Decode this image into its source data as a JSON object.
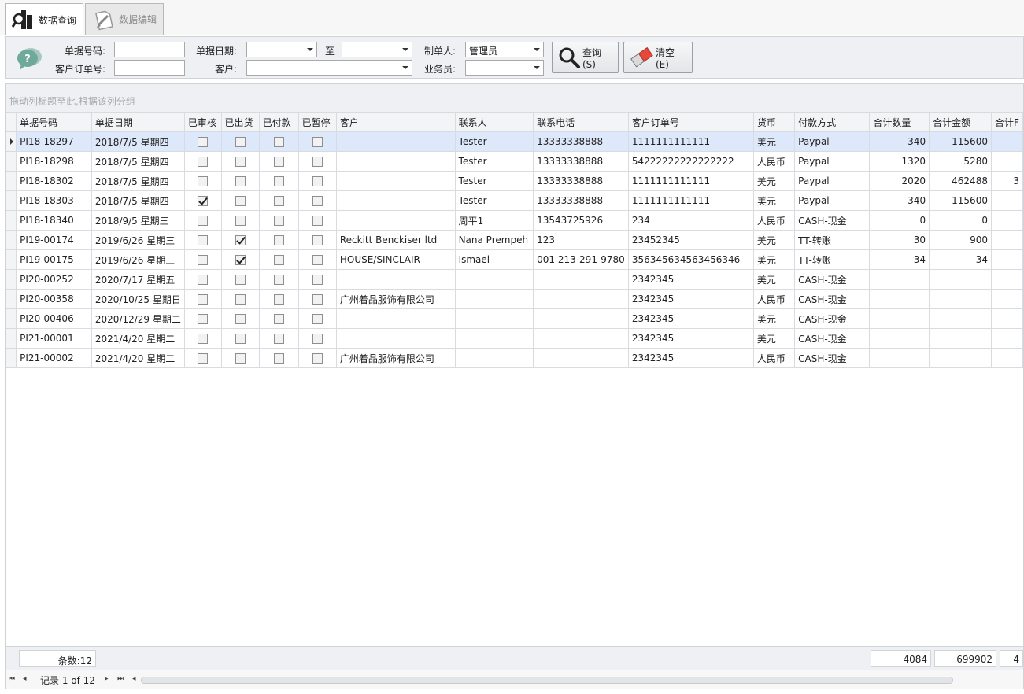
{
  "tabs": [
    {
      "label": "数据查询",
      "active": true
    },
    {
      "label": "数据编辑",
      "active": false
    }
  ],
  "search": {
    "doc_no_label": "单据号码:",
    "doc_no_value": "",
    "doc_date_label": "单据日期:",
    "date_from": "",
    "to_label": "至",
    "date_to": "",
    "maker_label": "制单人:",
    "maker_value": "管理员",
    "cust_order_label": "客户订单号:",
    "cust_order_value": "",
    "customer_label": "客户:",
    "customer_value": "",
    "salesman_label": "业务员:",
    "salesman_value": "",
    "query_button": "查询(S)",
    "clear_button": "清空(E)"
  },
  "grid": {
    "group_hint": "拖动列标题至此,根据该列分组",
    "columns": [
      "单据号码",
      "单据日期",
      "已审核",
      "已出货",
      "已付款",
      "已暂停",
      "客户",
      "联系人",
      "联系电话",
      "客户订单号",
      "货币",
      "付款方式",
      "合计数量",
      "合计金额",
      "合计F"
    ],
    "rows": [
      {
        "no": "PI18-18297",
        "date": "2018/7/5 星期四",
        "audited": false,
        "shipped": false,
        "paid": false,
        "paused": false,
        "customer": "",
        "contact": "Tester",
        "phone": "13333338888",
        "order": "1111111111111",
        "currency": "美元",
        "pay": "Paypal",
        "qty": "340",
        "amount": "115600",
        "extra": ""
      },
      {
        "no": "PI18-18298",
        "date": "2018/7/5 星期四",
        "audited": false,
        "shipped": false,
        "paid": false,
        "paused": false,
        "customer": "",
        "contact": "Tester",
        "phone": "13333338888",
        "order": "54222222222222222",
        "currency": "人民币",
        "pay": "Paypal",
        "qty": "1320",
        "amount": "5280",
        "extra": ""
      },
      {
        "no": "PI18-18302",
        "date": "2018/7/5 星期四",
        "audited": false,
        "shipped": false,
        "paid": false,
        "paused": false,
        "customer": "",
        "contact": "Tester",
        "phone": "13333338888",
        "order": "1111111111111",
        "currency": "美元",
        "pay": "Paypal",
        "qty": "2020",
        "amount": "462488",
        "extra": "3"
      },
      {
        "no": "PI18-18303",
        "date": "2018/7/5 星期四",
        "audited": true,
        "shipped": false,
        "paid": false,
        "paused": false,
        "customer": "",
        "contact": "Tester",
        "phone": "13333338888",
        "order": "1111111111111",
        "currency": "美元",
        "pay": "Paypal",
        "qty": "340",
        "amount": "115600",
        "extra": ""
      },
      {
        "no": "PI18-18340",
        "date": "2018/9/5 星期三",
        "audited": false,
        "shipped": false,
        "paid": false,
        "paused": false,
        "customer": "",
        "contact": "周平1",
        "phone": "13543725926",
        "order": "234",
        "currency": "人民币",
        "pay": "CASH-现金",
        "qty": "0",
        "amount": "0",
        "extra": ""
      },
      {
        "no": "PI19-00174",
        "date": "2019/6/26 星期三",
        "audited": false,
        "shipped": true,
        "paid": false,
        "paused": false,
        "customer": "Reckitt Benckiser ltd",
        "contact": "Nana Prempeh",
        "phone": "123",
        "order": "23452345",
        "currency": "美元",
        "pay": "TT-转账",
        "qty": "30",
        "amount": "900",
        "extra": ""
      },
      {
        "no": "PI19-00175",
        "date": "2019/6/26 星期三",
        "audited": false,
        "shipped": true,
        "paid": false,
        "paused": false,
        "customer": "HOUSE/SINCLAIR",
        "contact": "Ismael",
        "phone": "001 213-291-9780",
        "order": "356345634563456346",
        "currency": "美元",
        "pay": "TT-转账",
        "qty": "34",
        "amount": "34",
        "extra": ""
      },
      {
        "no": "PI20-00252",
        "date": "2020/7/17 星期五",
        "audited": false,
        "shipped": false,
        "paid": false,
        "paused": false,
        "customer": "",
        "contact": "",
        "phone": "",
        "order": "2342345",
        "currency": "美元",
        "pay": "CASH-现金",
        "qty": "",
        "amount": "",
        "extra": ""
      },
      {
        "no": "PI20-00358",
        "date": "2020/10/25 星期日",
        "audited": false,
        "shipped": false,
        "paid": false,
        "paused": false,
        "customer": "广州着品服饰有限公司",
        "contact": "",
        "phone": "",
        "order": "2342345",
        "currency": "人民币",
        "pay": "CASH-现金",
        "qty": "",
        "amount": "",
        "extra": ""
      },
      {
        "no": "PI20-00406",
        "date": "2020/12/29 星期二",
        "audited": false,
        "shipped": false,
        "paid": false,
        "paused": false,
        "customer": "",
        "contact": "",
        "phone": "",
        "order": "2342345",
        "currency": "美元",
        "pay": "CASH-现金",
        "qty": "",
        "amount": "",
        "extra": ""
      },
      {
        "no": "PI21-00001",
        "date": "2021/4/20 星期二",
        "audited": false,
        "shipped": false,
        "paid": false,
        "paused": false,
        "customer": "",
        "contact": "",
        "phone": "",
        "order": "2342345",
        "currency": "美元",
        "pay": "CASH-现金",
        "qty": "",
        "amount": "",
        "extra": ""
      },
      {
        "no": "PI21-00002",
        "date": "2021/4/20 星期二",
        "audited": false,
        "shipped": false,
        "paid": false,
        "paused": false,
        "customer": "广州着品服饰有限公司",
        "contact": "",
        "phone": "",
        "order": "2342345",
        "currency": "人民币",
        "pay": "CASH-现金",
        "qty": "",
        "amount": "",
        "extra": ""
      }
    ],
    "footer": {
      "count": "条数:12",
      "qty_total": "4084",
      "amount_total": "699902",
      "extra_total": "4"
    },
    "nav": {
      "record_text": "记录 1 of 12"
    }
  }
}
